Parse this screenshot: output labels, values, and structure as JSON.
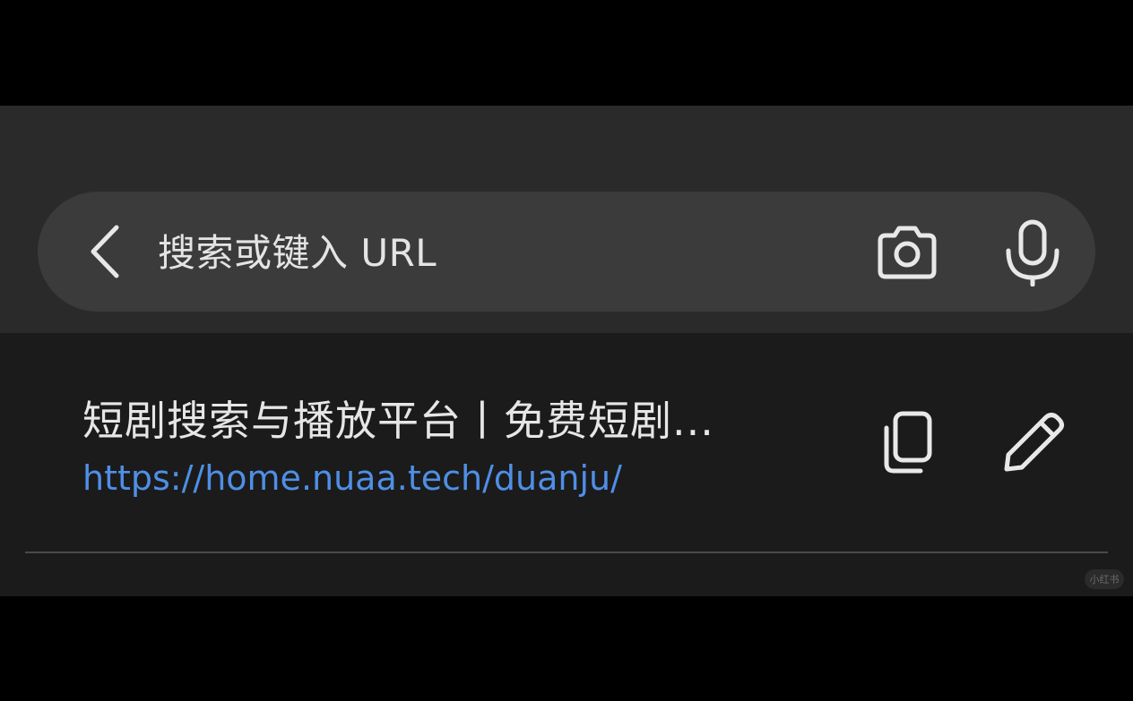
{
  "search": {
    "placeholder": "搜索或键入 URL",
    "value": ""
  },
  "icons": {
    "back": "chevron-left-icon",
    "camera": "camera-icon",
    "microphone": "microphone-icon",
    "copy": "copy-icon",
    "edit": "pencil-icon"
  },
  "suggestions": [
    {
      "title": "短剧搜索与播放平台丨免费短剧...",
      "url": "https://home.nuaa.tech/duanju/"
    }
  ],
  "watermark": "小红书",
  "colors": {
    "background": "#000000",
    "header_bg": "#2a2a2a",
    "search_bar_bg": "#3b3b3b",
    "results_bg": "#1b1b1b",
    "title_text": "#e6e6e6",
    "url_text": "#4f8fe6",
    "icon": "#e8e8e8"
  }
}
